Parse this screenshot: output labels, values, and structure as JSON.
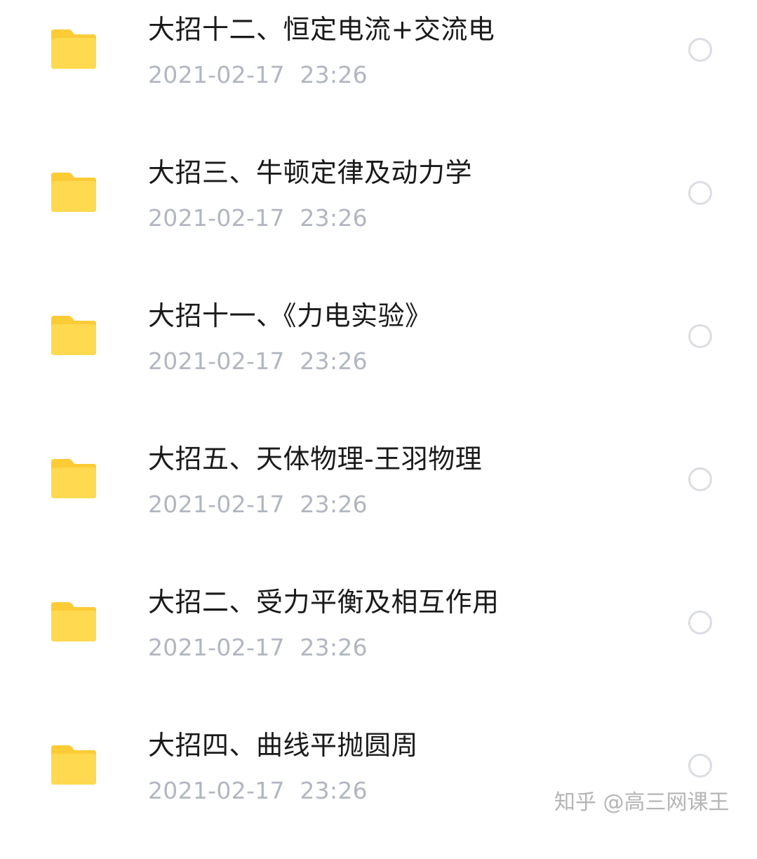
{
  "items": [
    {
      "title": "大招十二、恒定电流+交流电",
      "date": "2021-02-17  23:26",
      "icon": "folder-icon",
      "selected": false
    },
    {
      "title": "大招三、牛顿定律及动力学",
      "date": "2021-02-17  23:26",
      "icon": "folder-icon",
      "selected": false
    },
    {
      "title": "大招十一、《力电实验》",
      "date": "2021-02-17  23:26",
      "icon": "folder-icon",
      "selected": false
    },
    {
      "title": "大招五、天体物理-王羽物理",
      "date": "2021-02-17  23:26",
      "icon": "folder-icon",
      "selected": false
    },
    {
      "title": "大招二、受力平衡及相互作用",
      "date": "2021-02-17  23:26",
      "icon": "folder-icon",
      "selected": false
    },
    {
      "title": "大招四、曲线平抛圆周",
      "date": "2021-02-17  23:26",
      "icon": "folder-icon",
      "selected": false
    }
  ],
  "watermark": "知乎 @高三网课王",
  "colors": {
    "folder": "#ffd94f",
    "folder_tab": "#fccb36",
    "title": "#1a1a1a",
    "date": "#b1b6c1",
    "radio_border": "#dadde3"
  }
}
